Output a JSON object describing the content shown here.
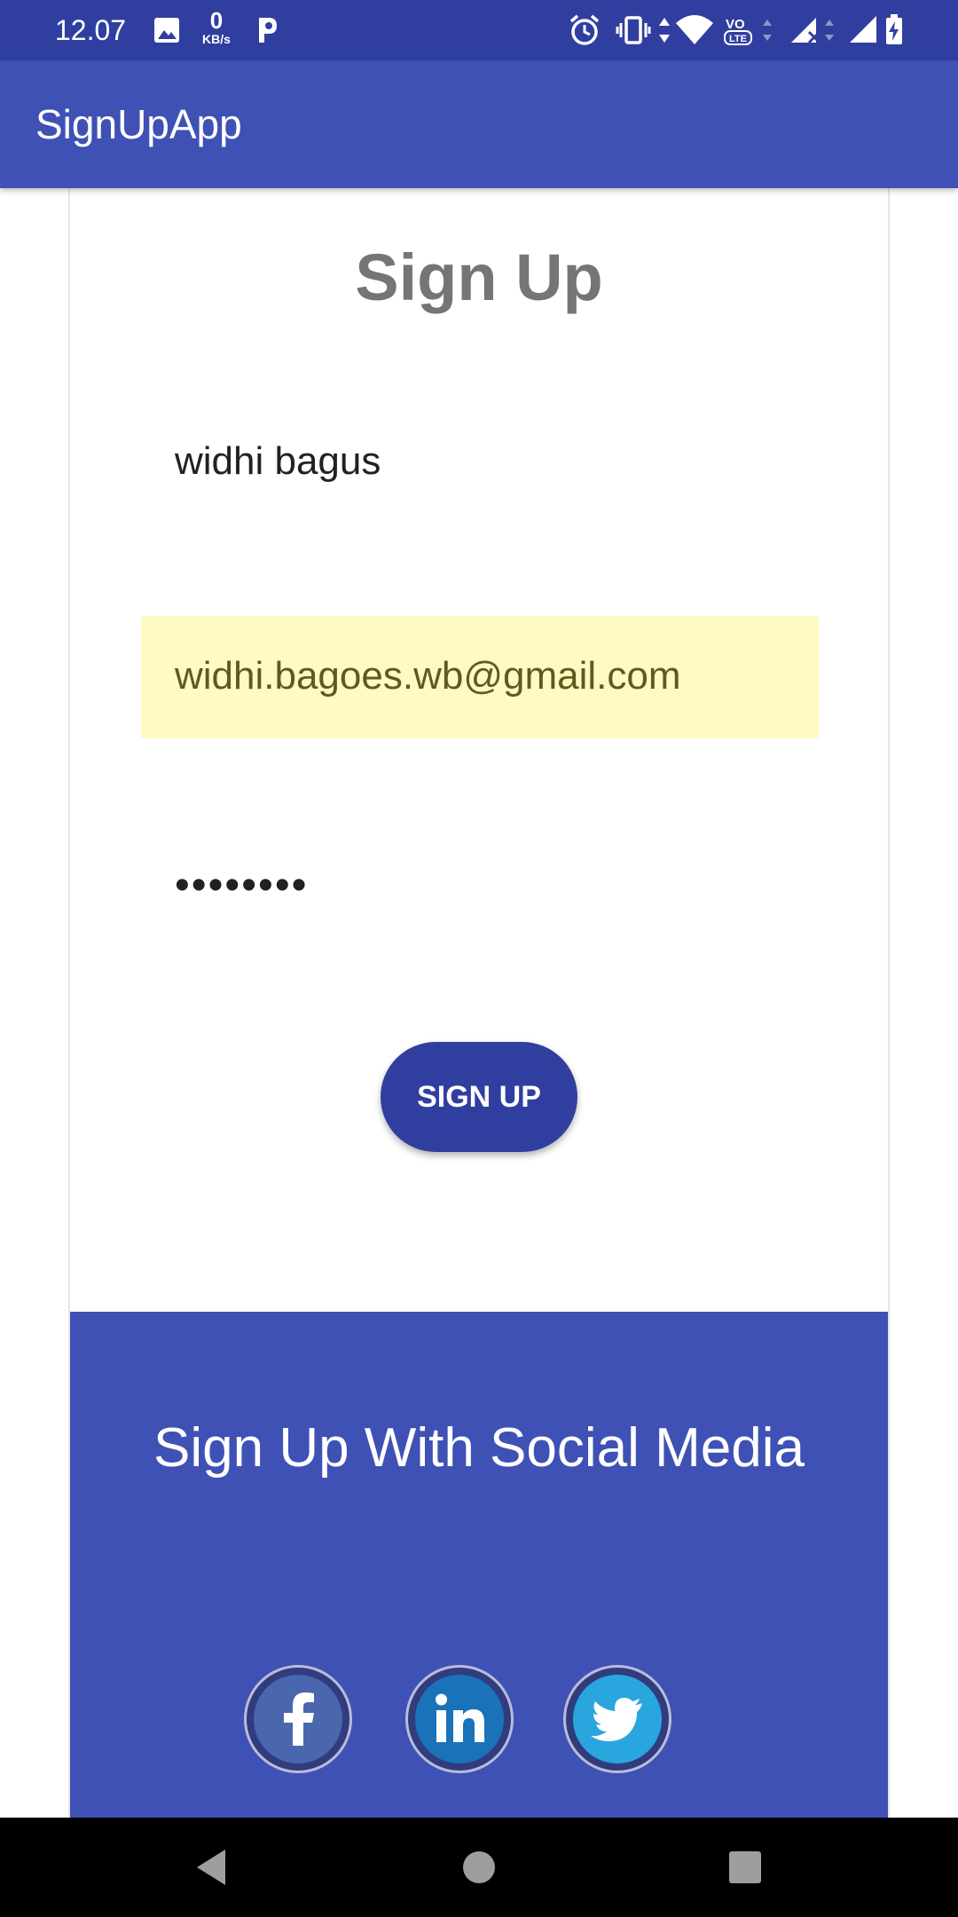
{
  "status_bar": {
    "time": "12.07",
    "network_speed_value": "0",
    "network_speed_unit": "KB/s",
    "icons": [
      "image-icon",
      "parking-icon",
      "alarm-icon",
      "vibrate-icon",
      "data-arrows-icon",
      "wifi-icon",
      "volte-icon",
      "signal-x-icon",
      "signal-icon",
      "battery-charging-icon"
    ]
  },
  "app_bar": {
    "title": "SignUpApp"
  },
  "form": {
    "title": "Sign Up",
    "name_value": "widhi bagus",
    "email_value": "widhi.bagoes.wb@gmail.com",
    "password_value": "••••••••",
    "submit_label": "SIGN UP"
  },
  "social": {
    "title": "Sign Up With Social Media",
    "buttons": [
      "facebook-icon",
      "linkedin-icon",
      "twitter-icon"
    ],
    "colors": {
      "panel": "#3f51b5",
      "facebook": "#4a66ac",
      "linkedin": "#1a72b8",
      "twitter": "#2aa6de"
    }
  },
  "colors": {
    "primary": "#3f51b5",
    "primary_dark": "#303f9f",
    "autofill": "#fff9c4",
    "title_gray": "#757575"
  },
  "nav_bar": {
    "icons": [
      "back-icon",
      "home-icon",
      "recents-icon"
    ]
  }
}
